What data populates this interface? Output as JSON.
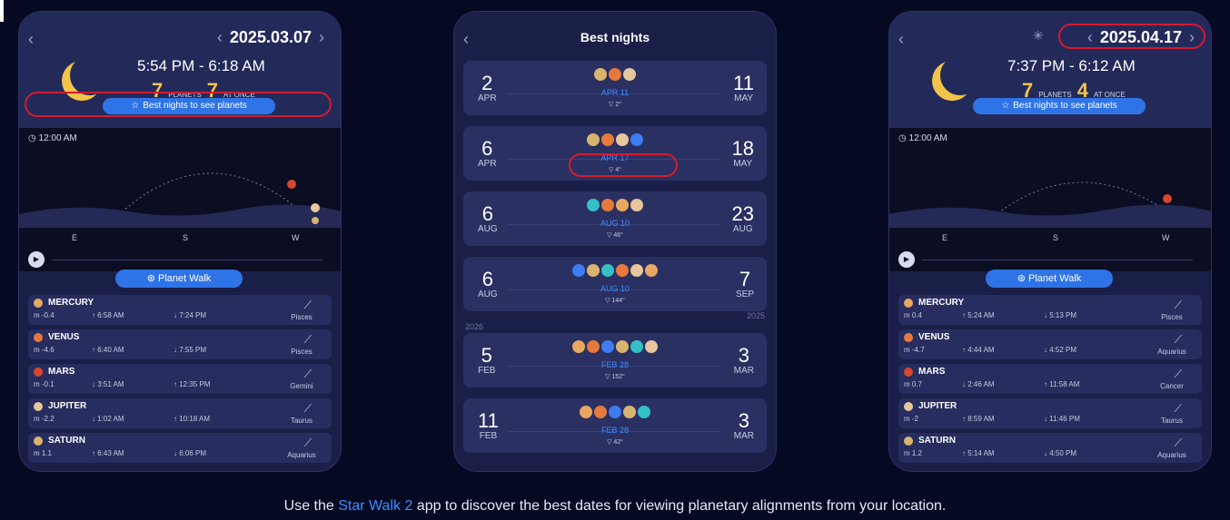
{
  "phone1": {
    "date": "2025.03.07",
    "time_range": "5:54 PM - 6:18 AM",
    "planets_count": "7",
    "planets_label": "PLANETS",
    "at_once_count": "7",
    "at_once_label": "AT ONCE",
    "best_button": "Best nights to see planets",
    "clock": "12:00 AM",
    "compass": [
      "E",
      "S",
      "W"
    ],
    "walk_button": "Planet Walk",
    "planets": [
      {
        "name": "MERCURY",
        "mag": "m -0.4",
        "rise": "↑ 6:58 AM",
        "set": "↓ 7:24 PM",
        "constellation": "Pisces",
        "color": "#e8a861"
      },
      {
        "name": "VENUS",
        "mag": "m -4.6",
        "rise": "↑ 6:40 AM",
        "set": "↓ 7:55 PM",
        "constellation": "Pisces",
        "color": "#e57a3c"
      },
      {
        "name": "MARS",
        "mag": "m -0.1",
        "rise": "↓ 3:51 AM",
        "set": "↑ 12:35 PM",
        "constellation": "Gemini",
        "color": "#d9452f"
      },
      {
        "name": "JUPITER",
        "mag": "m -2.2",
        "rise": "↓ 1:02 AM",
        "set": "↑ 10:18 AM",
        "constellation": "Taurus",
        "color": "#e6c79b"
      },
      {
        "name": "SATURN",
        "mag": "m 1.1",
        "rise": "↑ 6:43 AM",
        "set": "↓ 6:06 PM",
        "constellation": "Aquarius",
        "color": "#d9b46f"
      }
    ]
  },
  "phone2": {
    "title": "Best nights",
    "year_2025": "2025",
    "year_2026": "2026",
    "cards": [
      {
        "start_day": "2",
        "start_mon": "APR",
        "end_day": "11",
        "end_mon": "MAY",
        "peak": "APR 11",
        "angle": "▽ 2°",
        "planets": [
          "#d9b46f",
          "#e57a3c",
          "#e6c79b"
        ]
      },
      {
        "start_day": "6",
        "start_mon": "APR",
        "end_day": "18",
        "end_mon": "MAY",
        "peak": "APR 17",
        "angle": "▽ 4°",
        "planets": [
          "#d9b46f",
          "#e57a3c",
          "#e6c79b",
          "#3e7cf0"
        ]
      },
      {
        "start_day": "6",
        "start_mon": "AUG",
        "end_day": "23",
        "end_mon": "AUG",
        "peak": "AUG 10",
        "angle": "▽ 46°",
        "planets": [
          "#35c0c6",
          "#e57a3c",
          "#e8a861",
          "#e6c79b"
        ]
      },
      {
        "start_day": "6",
        "start_mon": "AUG",
        "end_day": "7",
        "end_mon": "SEP",
        "peak": "AUG 10",
        "angle": "▽ 144°",
        "planets": [
          "#3e7cf0",
          "#d9b46f",
          "#35c0c6",
          "#e57a3c",
          "#e6c79b",
          "#e8a861"
        ]
      },
      {
        "start_day": "5",
        "start_mon": "FEB",
        "end_day": "3",
        "end_mon": "MAR",
        "peak": "FEB 28",
        "angle": "▽ 152°",
        "planets": [
          "#e8a861",
          "#e57a3c",
          "#3e7cf0",
          "#d9b46f",
          "#35c0c6",
          "#e6c79b"
        ]
      },
      {
        "start_day": "11",
        "start_mon": "FEB",
        "end_day": "3",
        "end_mon": "MAR",
        "peak": "FEB 28",
        "angle": "▽ 42°",
        "planets": [
          "#e8a861",
          "#e57a3c",
          "#3e7cf0",
          "#d9b46f",
          "#35c0c6"
        ]
      }
    ]
  },
  "phone3": {
    "date": "2025.04.17",
    "time_range": "7:37 PM - 6:12 AM",
    "planets_count": "7",
    "planets_label": "PLANETS",
    "at_once_count": "4",
    "at_once_label": "AT ONCE",
    "best_button": "Best nights to see planets",
    "clock": "12:00 AM",
    "compass": [
      "E",
      "S",
      "W"
    ],
    "walk_button": "Planet Walk",
    "planets": [
      {
        "name": "MERCURY",
        "mag": "m 0.4",
        "rise": "↑ 5:24 AM",
        "set": "↓ 5:13 PM",
        "constellation": "Pisces",
        "color": "#e8a861"
      },
      {
        "name": "VENUS",
        "mag": "m -4.7",
        "rise": "↑ 4:44 AM",
        "set": "↓ 4:52 PM",
        "constellation": "Aquarius",
        "color": "#e57a3c"
      },
      {
        "name": "MARS",
        "mag": "m 0.7",
        "rise": "↓ 2:46 AM",
        "set": "↑ 11:58 AM",
        "constellation": "Cancer",
        "color": "#d9452f"
      },
      {
        "name": "JUPITER",
        "mag": "m -2",
        "rise": "↑ 8:59 AM",
        "set": "↓ 11:46 PM",
        "constellation": "Taurus",
        "color": "#e6c79b"
      },
      {
        "name": "SATURN",
        "mag": "m 1.2",
        "rise": "↑ 5:14 AM",
        "set": "↓ 4:50 PM",
        "constellation": "Aquarius",
        "color": "#d9b46f"
      }
    ]
  },
  "caption": {
    "before": "Use the ",
    "link": "Star Walk 2",
    "after": " app to discover the best dates for viewing planetary alignments from your location."
  },
  "colors": {
    "accent": "#2f74e6",
    "highlight": "#d51a2f",
    "moon": "#f2c44a"
  }
}
